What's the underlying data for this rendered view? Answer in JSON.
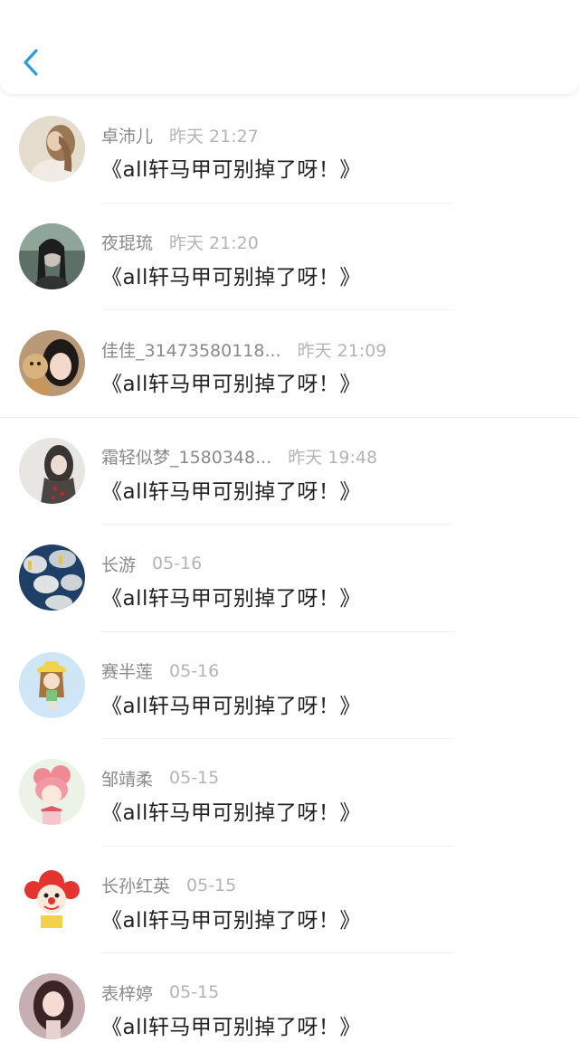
{
  "colors": {
    "accent": "#2d9cdb",
    "username": "#8a8a8a",
    "time": "#b4b4b4",
    "message": "#222222"
  },
  "header": {
    "back_icon": "chevron-left-icon"
  },
  "items": [
    {
      "name": "卓沛儿",
      "time": "昨天 21:27",
      "message": "《all轩马甲可别掉了呀！》"
    },
    {
      "name": "夜琨琉",
      "time": "昨天 21:20",
      "message": "《all轩马甲可别掉了呀！》"
    },
    {
      "name": "佳佳_31473580118...",
      "time": "昨天 21:09",
      "message": "《all轩马甲可别掉了呀！》"
    },
    {
      "name": "霜轻似梦_1580348...",
      "time": "昨天 19:48",
      "message": "《all轩马甲可别掉了呀！》"
    },
    {
      "name": "长游",
      "time": "05-16",
      "message": "《all轩马甲可别掉了呀！》"
    },
    {
      "name": "赛半莲",
      "time": "05-16",
      "message": "《all轩马甲可别掉了呀！》"
    },
    {
      "name": "邹靖柔",
      "time": "05-15",
      "message": "《all轩马甲可别掉了呀！》"
    },
    {
      "name": "长孙红英",
      "time": "05-15",
      "message": "《all轩马甲可别掉了呀！》"
    },
    {
      "name": "表梓婷",
      "time": "05-15",
      "message": "《all轩马甲可别掉了呀！》"
    }
  ]
}
